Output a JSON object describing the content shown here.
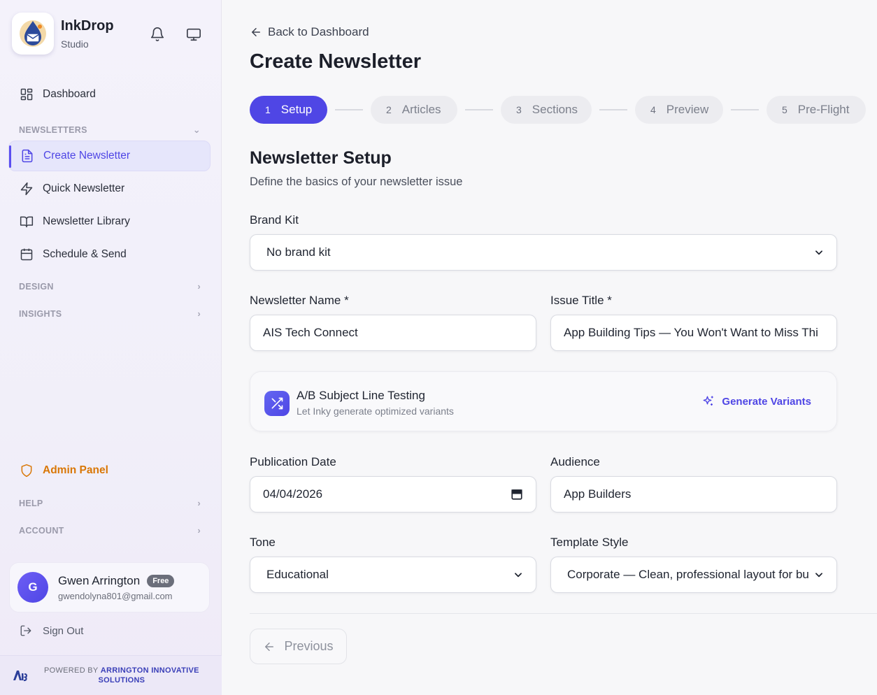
{
  "brand": {
    "name": "InkDrop",
    "subtitle": "Studio"
  },
  "sidebar": {
    "dashboard": "Dashboard",
    "newsletters_label": "NEWSLETTERS",
    "items": [
      "Create Newsletter",
      "Quick Newsletter",
      "Newsletter Library",
      "Schedule & Send"
    ],
    "design_label": "DESIGN",
    "insights_label": "INSIGHTS",
    "admin": "Admin Panel",
    "help_label": "HELP",
    "account_label": "ACCOUNT",
    "sign_out": "Sign Out"
  },
  "user": {
    "initial": "G",
    "name": "Gwen Arrington",
    "plan": "Free",
    "email": "gwendolyna801@gmail.com"
  },
  "footer": {
    "powered_by": "POWERED BY",
    "company": "ARRINGTON INNOVATIVE",
    "company2": "SOLUTIONS"
  },
  "main": {
    "back": "Back to Dashboard",
    "title": "Create Newsletter",
    "steps": [
      {
        "num": "1",
        "label": "Setup"
      },
      {
        "num": "2",
        "label": "Articles"
      },
      {
        "num": "3",
        "label": "Sections"
      },
      {
        "num": "4",
        "label": "Preview"
      },
      {
        "num": "5",
        "label": "Pre-Flight"
      }
    ],
    "section_title": "Newsletter Setup",
    "section_sub": "Define the basics of your newsletter issue"
  },
  "form": {
    "brand_kit_label": "Brand Kit",
    "brand_kit_value": "No brand kit",
    "name_label": "Newsletter Name *",
    "name_value": "AIS Tech Connect",
    "issue_label": "Issue Title *",
    "issue_value": "App Building Tips — You Won't Want to Miss Thi",
    "ab_title": "A/B Subject Line Testing",
    "ab_sub": "Let Inky generate optimized variants",
    "ab_action": "Generate Variants",
    "date_label": "Publication Date",
    "date_value": "04/04/2026",
    "audience_label": "Audience",
    "audience_value": "App Builders",
    "tone_label": "Tone",
    "tone_value": "Educational",
    "template_label": "Template Style",
    "template_value": "Corporate — Clean, professional layout for bu"
  },
  "nav": {
    "previous": "Previous"
  },
  "colors": {
    "accent": "#4f46e5",
    "admin": "#d97706"
  }
}
